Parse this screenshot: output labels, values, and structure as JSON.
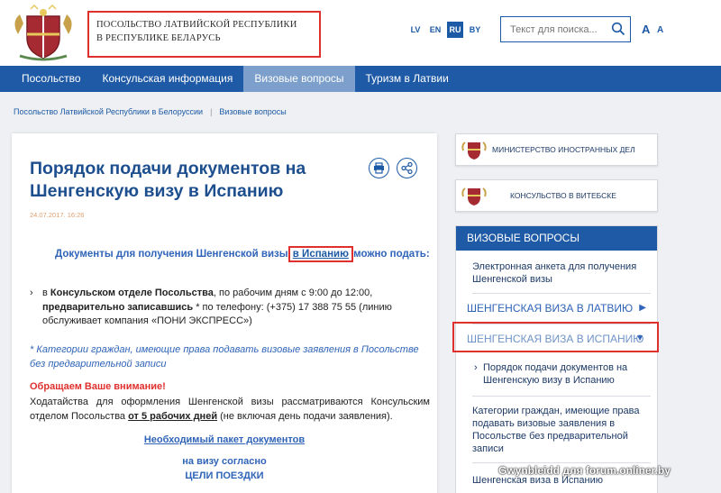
{
  "header": {
    "title_line1": "ПОСОЛЬСТВО ЛАТВИЙСКОЙ РЕСПУБЛИКИ",
    "title_line2": "В РЕСПУБЛИКЕ БЕЛАРУСЬ",
    "languages": [
      "LV",
      "EN",
      "RU",
      "BY"
    ],
    "active_language": "RU",
    "search_placeholder": "Текст для поиска...",
    "font_large": "A",
    "font_small": "A"
  },
  "nav": {
    "items": [
      "Посольство",
      "Консульская информация",
      "Визовые вопросы",
      "Туризм в Латвии"
    ],
    "active": "Визовые вопросы"
  },
  "breadcrumb": {
    "items": [
      "Посольство Латвийской Республики в Белоруссии",
      "Визовые вопросы"
    ]
  },
  "article": {
    "title": "Порядок подачи документов на Шенгенскую визу в Испанию",
    "date": "24.07.2017. 16:26",
    "docs_pre": "Документы для получения Шенгенской визы ",
    "docs_link": "в Испанию",
    "docs_post": " можно подать:",
    "bullet_pre": "в ",
    "bullet_bold1": "Консульском отделе Посольства",
    "bullet_mid": ", по рабочим дням с 9:00 до 12:00,",
    "bullet_bold2": "предварительно записавшись",
    "bullet_rest": " * по телефону: (+375) 17 388 75 55 (линию обслуживает компания «ПОНИ ЭКСПРЕСС»)",
    "note": "* Категории граждан, имеющие права подавать визовые заявления в Посольстве без предварительной записи",
    "attention": "Обращаем Ваше внимание!",
    "para_pre": "Ходатайства для оформления Шенгенской визы рассматриваются Консульским отделом Посольства ",
    "para_bold": "от 5 рабочих дней",
    "para_post": " (не включая день подачи заявления).",
    "package_link": "Необходимый пакет документов",
    "visa_by": "на визу согласно",
    "purpose": "ЦЕЛИ ПОЕЗДКИ"
  },
  "sidebar": {
    "card1": "МИНИСТЕРСТВО ИНОСТРАННЫХ ДЕЛ",
    "card2": "КОНСУЛЬСТВО В ВИТЕБСКЕ",
    "panel_title": "ВИЗОВЫЕ ВОПРОСЫ",
    "item_anketa": "Электронная анкета для получения Шенгенской визы",
    "cat_latvia": "ШЕНГЕНСКАЯ ВИЗА В ЛАТВИЮ",
    "cat_spain": "ШЕНГЕНСКАЯ ВИЗА В ИСПАНИЮ",
    "sub_order": "Порядок подачи документов на Шенгенскую визу в Испанию",
    "sub_categories": "Категории граждан, имеющие права подавать визовые заявления в Посольстве без предварительной записи",
    "sub_spain": "Шенгенская виза в Испанию"
  },
  "watermark": "Gwynbleidd для forum.onliner.by",
  "colors": {
    "brand_blue": "#1f5aa6",
    "highlight_red": "#e0302e",
    "active_nav": "#7c9fcb"
  }
}
